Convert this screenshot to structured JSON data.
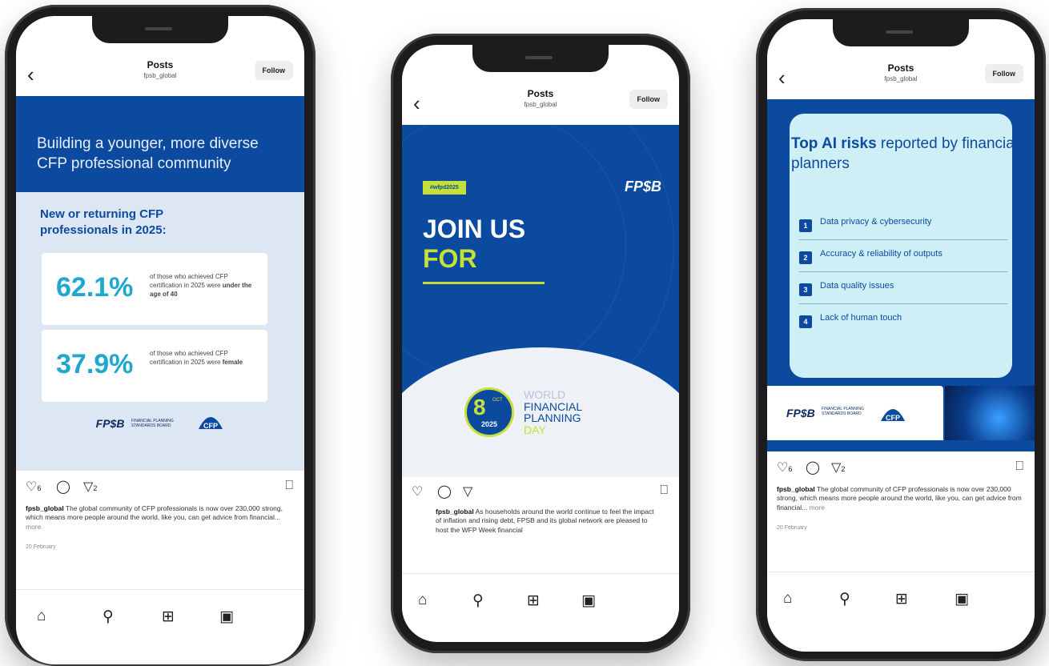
{
  "header": {
    "title": "Posts",
    "handle": "fpsb_global",
    "follow_label": "Follow"
  },
  "icons": {
    "back": "chevron-left-icon",
    "like": "heart-icon",
    "comment": "comment-icon",
    "share": "send-icon",
    "save": "bookmark-icon",
    "home": "home-icon",
    "search": "search-icon",
    "create": "plus-square-icon",
    "reels": "reels-icon"
  },
  "colors": {
    "brand_blue": "#0b4a9e",
    "accent_lime": "#c6e03a",
    "stat_cyan": "#1ea7cf"
  },
  "phone1": {
    "headline": "Building a younger, more diverse CFP professional community",
    "subheading": "New or returning CFP professionals in 2025:",
    "stats": [
      {
        "value": "62.1%",
        "desc_pre": "of those who achieved CFP certification in 2025 were ",
        "desc_bold": "under the age of 40"
      },
      {
        "value": "37.9%",
        "desc_pre": "of those who achieved CFP certification in 2025 were ",
        "desc_bold": "female"
      }
    ],
    "logo_text": "FP$B",
    "logo_sub": "FINANCIAL PLANNING STANDARDS BOARD",
    "cfp_logo_text": "CFP",
    "likes": "6",
    "shares": "2",
    "caption_user": "fpsb_global",
    "caption_text": " The global community of CFP professionals is now over 230,000 strong, which means more people around the world, like you, can get advice from financial...",
    "caption_more": " more",
    "date": "20 February"
  },
  "phone2": {
    "hashtag": "#wfpd2025",
    "logo_text": "FP$B",
    "join_line1": "JOIN US",
    "join_line2": "FOR",
    "date_day": "8",
    "date_month": "OCT",
    "date_year": "2025",
    "wfpd_line1": "WORLD",
    "wfpd_line2": "FINANCIAL",
    "wfpd_line3": "PLANNING",
    "wfpd_line4": "DAY",
    "caption_user": "fpsb_global",
    "caption_text": " As households around the world continue to feel the impact of inflation and rising debt, FPSB and its global network are pleased to host the WFP Week financial"
  },
  "phone3": {
    "title_bold": "Top AI risks",
    "title_rest": " reported by financial planners",
    "risks": [
      {
        "num": "1",
        "text": "Data privacy & cybersecurity"
      },
      {
        "num": "2",
        "text": "Accuracy & reliability of outputs"
      },
      {
        "num": "3",
        "text": "Data quality issues"
      },
      {
        "num": "4",
        "text": "Lack of human touch"
      }
    ],
    "logo_text": "FP$B",
    "logo_sub": "FINANCIAL PLANNING STANDARDS BOARD",
    "cfp_logo_text": "CFP",
    "likes": "6",
    "shares": "2",
    "caption_user": "fpsb_global",
    "caption_text": " The global community of CFP professionals is now over 230,000 strong, which means more people around the world, like you, can get advice from financial...",
    "caption_more": " more",
    "date": "20 February"
  }
}
